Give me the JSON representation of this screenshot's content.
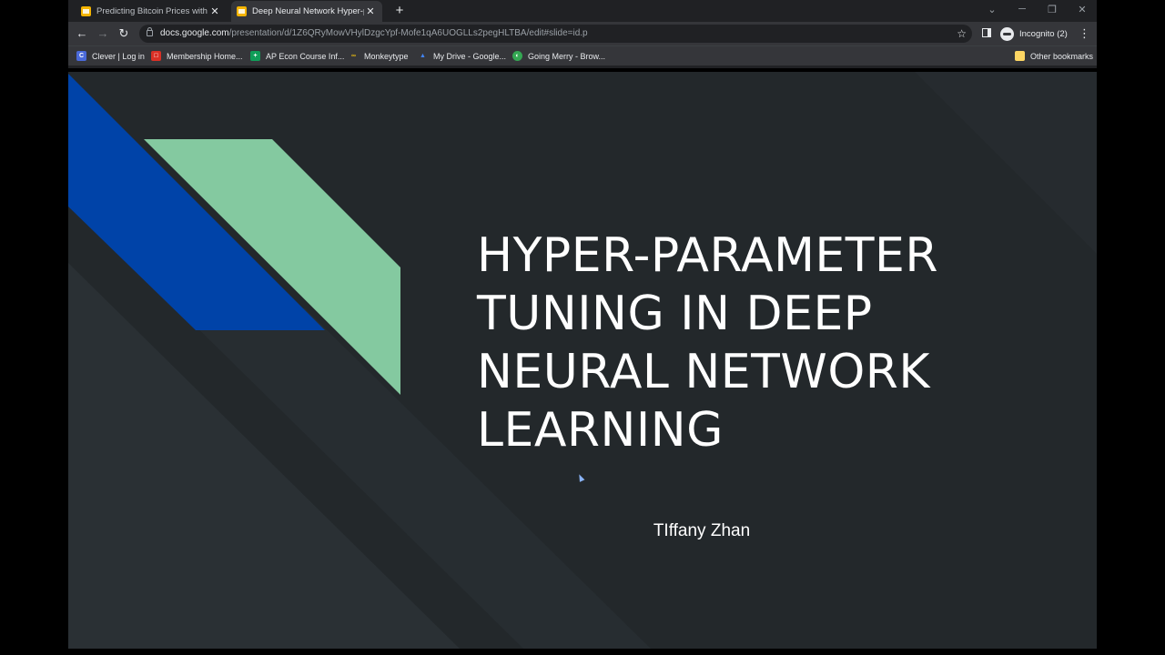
{
  "browser": {
    "tabs": [
      {
        "title": "Predicting Bitcoin Prices with Ne",
        "close": "✕",
        "active": false
      },
      {
        "title": "Deep Neural Network Hyper-para",
        "close": "✕",
        "active": true
      }
    ],
    "new_tab": "+",
    "window_controls": {
      "minimize": "─",
      "restore": "❐",
      "close": "✕",
      "dropdown": "⌄"
    },
    "nav": {
      "back": "←",
      "forward": "→",
      "reload": "↻"
    },
    "url": {
      "host": "docs.google.com",
      "path": "/presentation/d/1Z6QRyMowVHylDzgcYpf-Mofe1qA6UOGLLs2pegHLTBA/edit#slide=id.p"
    },
    "bookmark_star": "☆",
    "profile_label": "Incognito (2)",
    "menu": "⋮",
    "bookmarks": [
      {
        "label": "Clever | Log in",
        "icon": "clever-icon",
        "glyph": "C",
        "color": "#4a69d8"
      },
      {
        "label": "Membership Home...",
        "icon": "membership-icon",
        "glyph": "□",
        "color": "#d93025"
      },
      {
        "label": "AP Econ Course Inf...",
        "icon": "google-sites-icon",
        "glyph": "+",
        "color": "#0f9d58"
      },
      {
        "label": "Monkeytype",
        "icon": "monkeytype-icon",
        "glyph": "∞",
        "color": "#e2b714"
      },
      {
        "label": "My Drive - Google...",
        "icon": "google-drive-icon",
        "glyph": "▲",
        "color": "#4285f4"
      },
      {
        "label": "Going Merry - Brow...",
        "icon": "going-merry-icon",
        "glyph": "◐",
        "color": "#34a853"
      }
    ],
    "other_bookmarks": "Other bookmarks"
  },
  "slide": {
    "title": "HYPER-PARAMETER TUNING IN DEEP NEURAL NETWORK LEARNING",
    "author": "TIffany Zhan",
    "colors": {
      "background": "#23282b",
      "blue": "#0043a8",
      "green": "#84c9a0"
    }
  }
}
